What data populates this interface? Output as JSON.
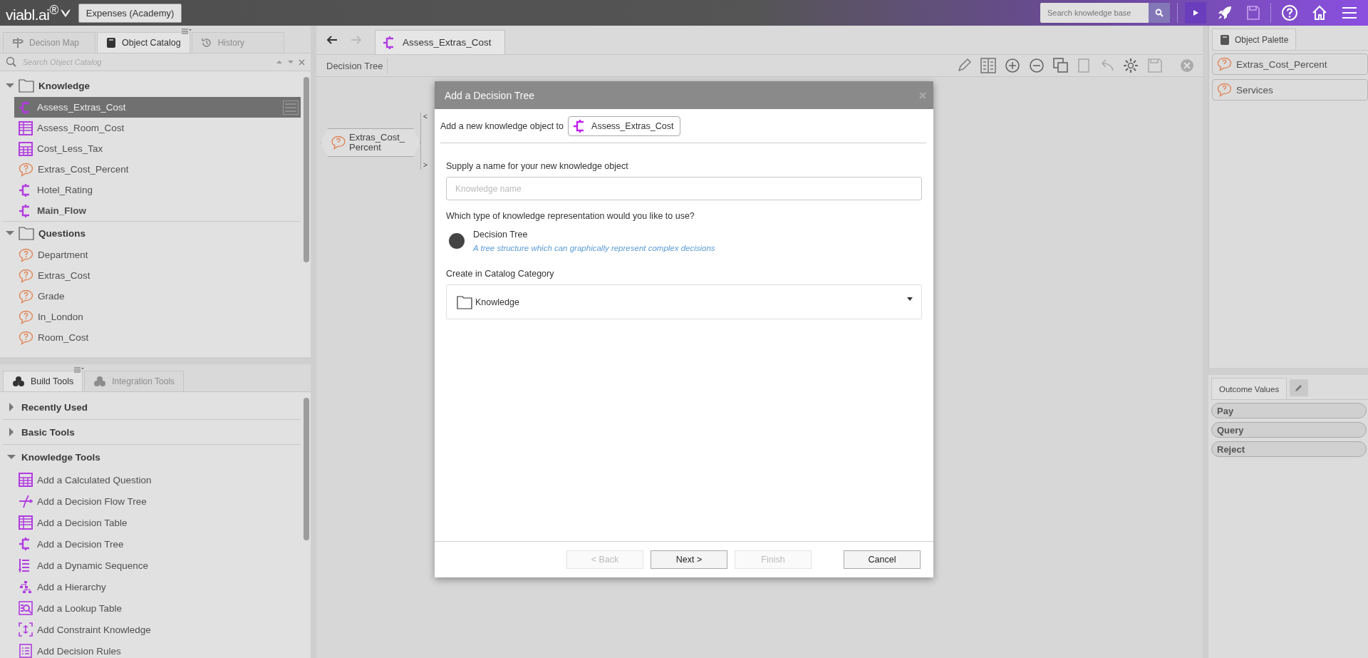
{
  "app": {
    "logo": "viabl.ai$^{®}$",
    "project": "Expenses (Academy)",
    "search_placeholder": "Search knowledge base"
  },
  "left_tabs": [
    {
      "label": "Decison Map",
      "selected": false,
      "disabled": true,
      "kind": "map"
    },
    {
      "label": "Object Catalog",
      "selected": true,
      "disabled": false,
      "kind": "book"
    },
    {
      "label": "History",
      "selected": false,
      "disabled": true,
      "kind": "history"
    }
  ],
  "catalog_search": {
    "placeholder": "Search Object Catalog"
  },
  "catalog": [
    {
      "label": "Knowledge",
      "expanded": true,
      "children": [
        {
          "label": "Assess_Extras_Cost",
          "kind": "tree",
          "selected": true,
          "bold": false
        },
        {
          "label": "Assess_Room_Cost",
          "kind": "table",
          "selected": false,
          "bold": false
        },
        {
          "label": "Cost_Less_Tax",
          "kind": "calc",
          "selected": false,
          "bold": false
        },
        {
          "label": "Extras_Cost_Percent",
          "kind": "question",
          "selected": false,
          "bold": false
        },
        {
          "label": "Hotel_Rating",
          "kind": "tree",
          "selected": false,
          "bold": false
        },
        {
          "label": "Main_Flow",
          "kind": "tree",
          "selected": false,
          "bold": true
        }
      ]
    },
    {
      "label": "Questions",
      "expanded": true,
      "children": [
        {
          "label": "Department",
          "kind": "question",
          "selected": false,
          "bold": false
        },
        {
          "label": "Extras_Cost",
          "kind": "question",
          "selected": false,
          "bold": false
        },
        {
          "label": "Grade",
          "kind": "question",
          "selected": false,
          "bold": false
        },
        {
          "label": "In_London",
          "kind": "question",
          "selected": false,
          "bold": false
        },
        {
          "label": "Room_Cost",
          "kind": "question",
          "selected": false,
          "bold": false
        }
      ]
    }
  ],
  "build_tabs": [
    {
      "label": "Build Tools",
      "selected": true
    },
    {
      "label": "Integration Tools",
      "selected": false
    }
  ],
  "tool_groups": [
    {
      "label": "Recently Used",
      "expanded": false
    },
    {
      "label": "Basic Tools",
      "expanded": false
    },
    {
      "label": "Knowledge Tools",
      "expanded": true,
      "children": [
        {
          "label": "Add a Calculated Question",
          "kind": "calc"
        },
        {
          "label": "Add a Decision Flow Tree",
          "kind": "flow"
        },
        {
          "label": "Add a Decision Table",
          "kind": "table"
        },
        {
          "label": "Add a Decision Tree",
          "kind": "tree"
        },
        {
          "label": "Add a Dynamic Sequence",
          "kind": "sequence"
        },
        {
          "label": "Add a Hierarchy",
          "kind": "hierarchy"
        },
        {
          "label": "Add a Lookup Table",
          "kind": "lookup"
        },
        {
          "label": "Add Constraint Knowledge",
          "kind": "constraint"
        },
        {
          "label": "Add Decision Rules",
          "kind": "rules"
        }
      ]
    }
  ],
  "editor": {
    "tabs": [
      {
        "label": "Assess_Extras_Cost",
        "selected": true
      }
    ],
    "view_label": "Decision Tree"
  },
  "canvas": {
    "node_lines": [
      "Extras_Cost_",
      "Percent"
    ],
    "branch_marks": [
      "<",
      ">"
    ]
  },
  "dialog": {
    "title": "Add a Decision Tree",
    "target_label": "Add a new knowledge object to",
    "target": "Assess_Extras_Cost",
    "name_label": "Supply a name for your new knowledge object",
    "name_placeholder": "Knowledge name",
    "type_question": "Which type of knowledge representation would you like to use?",
    "options": [
      {
        "label": "Decision Tree",
        "description": "A tree structure which can graphically represent complex decisions",
        "selected": true
      }
    ],
    "category_label": "Create in Catalog Category",
    "category": "Knowledge",
    "buttons": [
      {
        "label": "< Back",
        "disabled": true
      },
      {
        "label": "Next >",
        "disabled": false
      },
      {
        "label": "Finish",
        "disabled": true
      },
      {
        "label": "Cancel",
        "disabled": false
      }
    ]
  },
  "palette": {
    "tab": "Object Palette",
    "items": [
      "Extras_Cost_Percent",
      "Services"
    ]
  },
  "outcomes": {
    "tab": "Outcome Values",
    "items": [
      "Pay",
      "Query",
      "Reject"
    ]
  }
}
